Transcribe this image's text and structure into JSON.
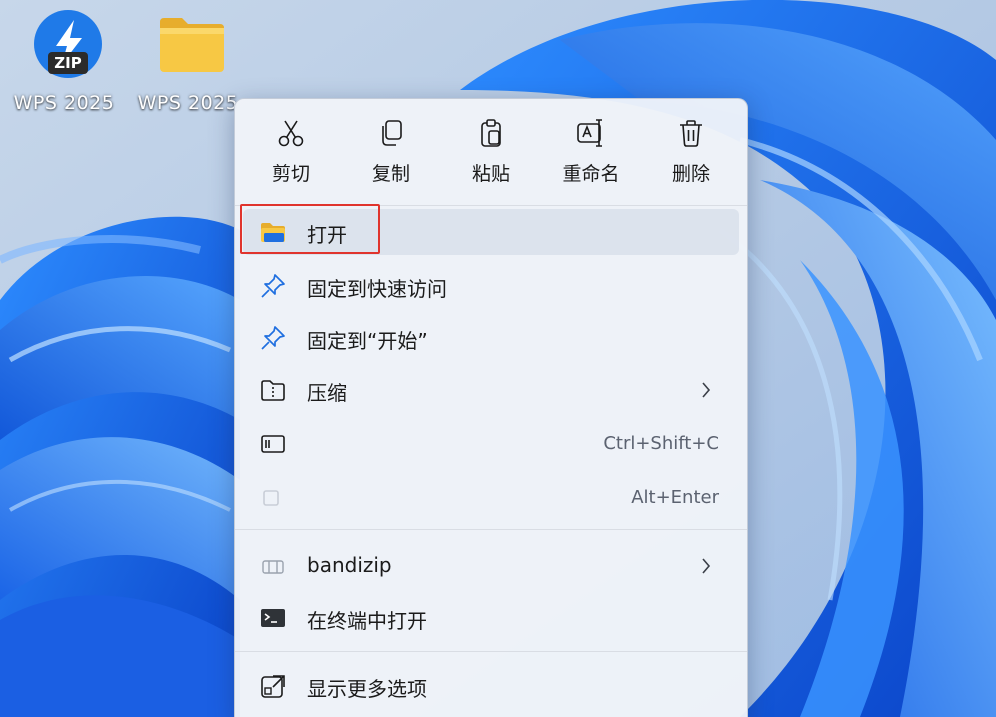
{
  "desktop": {
    "icons": [
      {
        "label": "WPS 2025",
        "type": "zip-archive",
        "badge": "ZIP"
      },
      {
        "label": "WPS 2025",
        "type": "folder"
      }
    ]
  },
  "context_menu": {
    "quick_actions": [
      {
        "label": "剪切",
        "icon": "scissors-icon"
      },
      {
        "label": "复制",
        "icon": "copy-icon"
      },
      {
        "label": "粘贴",
        "icon": "paste-icon"
      },
      {
        "label": "重命名",
        "icon": "rename-icon"
      },
      {
        "label": "删除",
        "icon": "trash-icon"
      }
    ],
    "items": [
      {
        "label": "打开",
        "icon": "folder-icon",
        "highlighted": true
      },
      {
        "label": "固定到快速访问",
        "icon": "pin-icon"
      },
      {
        "label": "固定到“开始”",
        "icon": "pin-icon"
      },
      {
        "label": "压缩",
        "icon": "zip-folder-icon",
        "submenu": true
      },
      {
        "label": "",
        "icon": "copy-path-icon",
        "shortcut": "Ctrl+Shift+C"
      },
      {
        "label": "",
        "icon": "properties-icon",
        "shortcut": "Alt+Enter"
      },
      {
        "label": "bandizip",
        "icon": "bandizip-icon",
        "submenu": true
      },
      {
        "label": "在终端中打开",
        "icon": "terminal-icon"
      },
      {
        "label": "显示更多选项",
        "icon": "more-options-icon"
      }
    ]
  },
  "colors": {
    "accent_blue": "#1f6fe0",
    "highlight_border": "#e0342d",
    "folder_yellow": "#f5c242"
  }
}
